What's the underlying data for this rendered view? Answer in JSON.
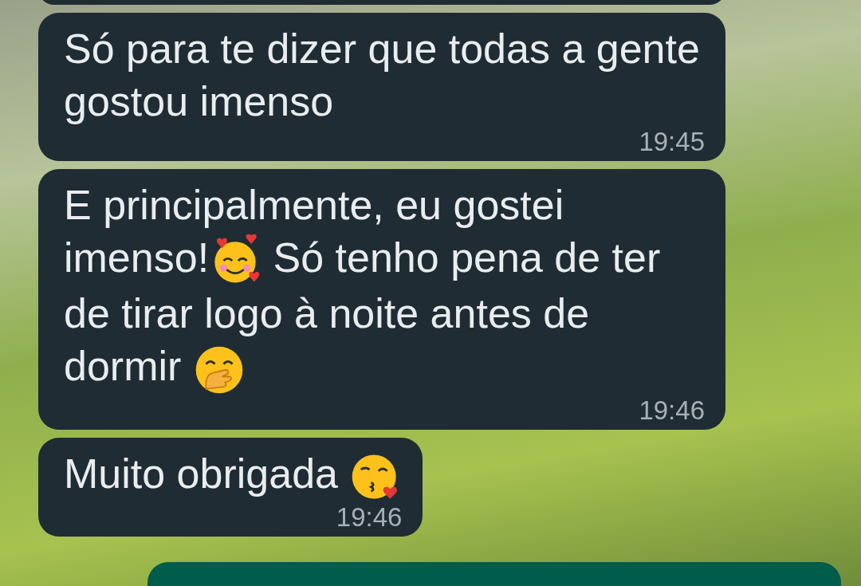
{
  "earlier_message_cut_off": true,
  "messages": [
    {
      "parts": [
        {
          "kind": "text",
          "text": "Só para te dizer que todas a gente gostou imenso"
        }
      ],
      "time": "19:45"
    },
    {
      "parts": [
        {
          "kind": "text",
          "text": "E principalmente, eu gostei imenso!"
        },
        {
          "kind": "hearts-emoji"
        },
        {
          "kind": "text",
          "text": " Só tenho pena de ter de tirar logo à noite antes de dormir "
        },
        {
          "kind": "hand-emoji"
        }
      ],
      "time": "19:46"
    },
    {
      "parts": [
        {
          "kind": "text",
          "text": "Muito obrigada "
        },
        {
          "kind": "kiss-emoji"
        }
      ],
      "time": "19:46"
    }
  ],
  "outgoing_message_cut_off": true
}
